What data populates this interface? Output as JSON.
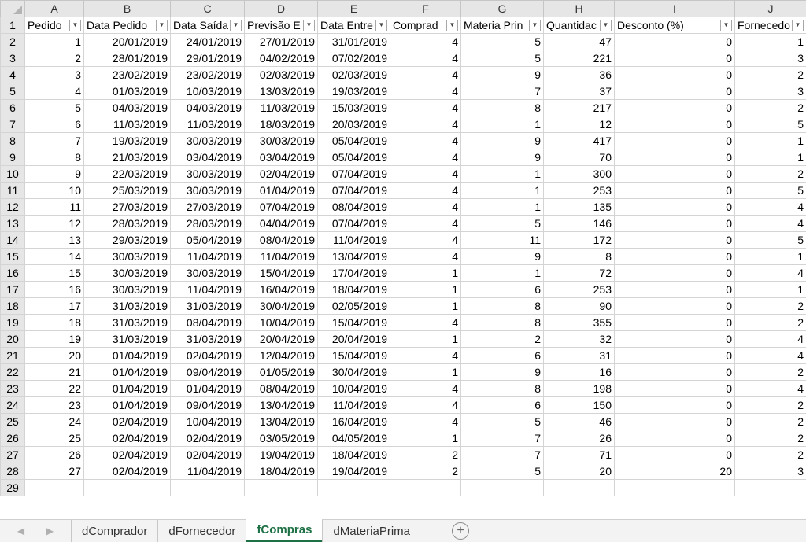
{
  "columns": [
    "A",
    "B",
    "C",
    "D",
    "E",
    "F",
    "G",
    "H",
    "I",
    "J"
  ],
  "headers": [
    "Pedido",
    "Data Pedido",
    "Data Saída",
    "Previsão E",
    "Data Entre",
    "Comprad",
    "Materia Prin",
    "Quantidac",
    "Desconto (%)",
    "Fornecedo"
  ],
  "rows": [
    [
      "1",
      "20/01/2019",
      "24/01/2019",
      "27/01/2019",
      "31/01/2019",
      "4",
      "5",
      "47",
      "0",
      "1"
    ],
    [
      "2",
      "28/01/2019",
      "29/01/2019",
      "04/02/2019",
      "07/02/2019",
      "4",
      "5",
      "221",
      "0",
      "3"
    ],
    [
      "3",
      "23/02/2019",
      "23/02/2019",
      "02/03/2019",
      "02/03/2019",
      "4",
      "9",
      "36",
      "0",
      "2"
    ],
    [
      "4",
      "01/03/2019",
      "10/03/2019",
      "13/03/2019",
      "19/03/2019",
      "4",
      "7",
      "37",
      "0",
      "3"
    ],
    [
      "5",
      "04/03/2019",
      "04/03/2019",
      "11/03/2019",
      "15/03/2019",
      "4",
      "8",
      "217",
      "0",
      "2"
    ],
    [
      "6",
      "11/03/2019",
      "11/03/2019",
      "18/03/2019",
      "20/03/2019",
      "4",
      "1",
      "12",
      "0",
      "5"
    ],
    [
      "7",
      "19/03/2019",
      "30/03/2019",
      "30/03/2019",
      "05/04/2019",
      "4",
      "9",
      "417",
      "0",
      "1"
    ],
    [
      "8",
      "21/03/2019",
      "03/04/2019",
      "03/04/2019",
      "05/04/2019",
      "4",
      "9",
      "70",
      "0",
      "1"
    ],
    [
      "9",
      "22/03/2019",
      "30/03/2019",
      "02/04/2019",
      "07/04/2019",
      "4",
      "1",
      "300",
      "0",
      "2"
    ],
    [
      "10",
      "25/03/2019",
      "30/03/2019",
      "01/04/2019",
      "07/04/2019",
      "4",
      "1",
      "253",
      "0",
      "5"
    ],
    [
      "11",
      "27/03/2019",
      "27/03/2019",
      "07/04/2019",
      "08/04/2019",
      "4",
      "1",
      "135",
      "0",
      "4"
    ],
    [
      "12",
      "28/03/2019",
      "28/03/2019",
      "04/04/2019",
      "07/04/2019",
      "4",
      "5",
      "146",
      "0",
      "4"
    ],
    [
      "13",
      "29/03/2019",
      "05/04/2019",
      "08/04/2019",
      "11/04/2019",
      "4",
      "11",
      "172",
      "0",
      "5"
    ],
    [
      "14",
      "30/03/2019",
      "11/04/2019",
      "11/04/2019",
      "13/04/2019",
      "4",
      "9",
      "8",
      "0",
      "1"
    ],
    [
      "15",
      "30/03/2019",
      "30/03/2019",
      "15/04/2019",
      "17/04/2019",
      "1",
      "1",
      "72",
      "0",
      "4"
    ],
    [
      "16",
      "30/03/2019",
      "11/04/2019",
      "16/04/2019",
      "18/04/2019",
      "1",
      "6",
      "253",
      "0",
      "1"
    ],
    [
      "17",
      "31/03/2019",
      "31/03/2019",
      "30/04/2019",
      "02/05/2019",
      "1",
      "8",
      "90",
      "0",
      "2"
    ],
    [
      "18",
      "31/03/2019",
      "08/04/2019",
      "10/04/2019",
      "15/04/2019",
      "4",
      "8",
      "355",
      "0",
      "2"
    ],
    [
      "19",
      "31/03/2019",
      "31/03/2019",
      "20/04/2019",
      "20/04/2019",
      "1",
      "2",
      "32",
      "0",
      "4"
    ],
    [
      "20",
      "01/04/2019",
      "02/04/2019",
      "12/04/2019",
      "15/04/2019",
      "4",
      "6",
      "31",
      "0",
      "4"
    ],
    [
      "21",
      "01/04/2019",
      "09/04/2019",
      "01/05/2019",
      "30/04/2019",
      "1",
      "9",
      "16",
      "0",
      "2"
    ],
    [
      "22",
      "01/04/2019",
      "01/04/2019",
      "08/04/2019",
      "10/04/2019",
      "4",
      "8",
      "198",
      "0",
      "4"
    ],
    [
      "23",
      "01/04/2019",
      "09/04/2019",
      "13/04/2019",
      "11/04/2019",
      "4",
      "6",
      "150",
      "0",
      "2"
    ],
    [
      "24",
      "02/04/2019",
      "10/04/2019",
      "13/04/2019",
      "16/04/2019",
      "4",
      "5",
      "46",
      "0",
      "2"
    ],
    [
      "25",
      "02/04/2019",
      "02/04/2019",
      "03/05/2019",
      "04/05/2019",
      "1",
      "7",
      "26",
      "0",
      "2"
    ],
    [
      "26",
      "02/04/2019",
      "02/04/2019",
      "19/04/2019",
      "18/04/2019",
      "2",
      "7",
      "71",
      "0",
      "2"
    ],
    [
      "27",
      "02/04/2019",
      "11/04/2019",
      "18/04/2019",
      "19/04/2019",
      "2",
      "5",
      "20",
      "20",
      "3"
    ]
  ],
  "sheet_tabs": [
    "dComprador",
    "dFornecedor",
    "fCompras",
    "dMateriaPrima"
  ],
  "active_tab": "fCompras",
  "add_sheet_label": "+"
}
